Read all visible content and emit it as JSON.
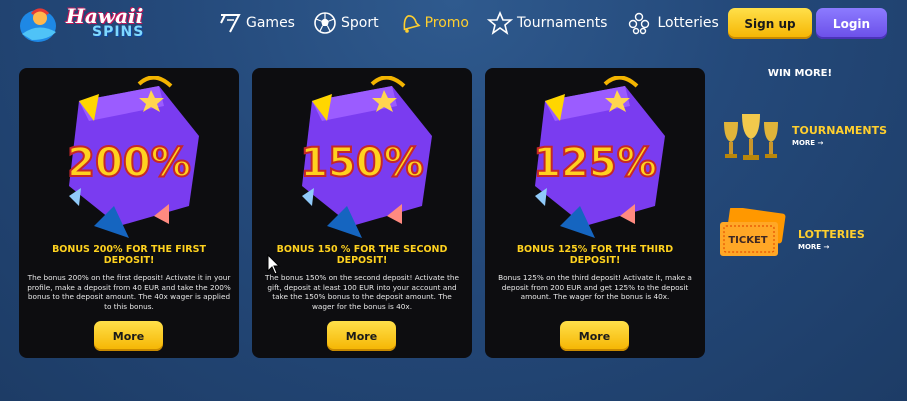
{
  "logo": {
    "line1": "Hawaii",
    "line2": "SPINS"
  },
  "nav": [
    {
      "label": "Games",
      "icon": "seven-icon"
    },
    {
      "label": "Sport",
      "icon": "soccer-ball-icon"
    },
    {
      "label": "Promo",
      "icon": "bell-icon",
      "active": true
    },
    {
      "label": "Tournaments",
      "icon": "star-icon"
    },
    {
      "label": "Lotteries",
      "icon": "lottery-balls-icon"
    }
  ],
  "auth": {
    "signup": "Sign up",
    "login": "Login"
  },
  "cards": [
    {
      "percent": "200%",
      "title": "BONUS 200% FOR THE FIRST DEPOSIT!",
      "description": "The bonus 200% on the first deposit! Activate it in your profile, make a deposit from 40 EUR and take the 200% bonus to the deposit amount. The 40x wager is applied to this bonus.",
      "button": "More"
    },
    {
      "percent": "150%",
      "title": "BONUS 150 % FOR THE SECOND DEPOSIT!",
      "description": "The bonus 150% on the second deposit! Activate the gift, deposit at least 100 EUR into your account and take the 150% bonus to the deposit amount. The wager for the bonus is 40x.",
      "button": "More"
    },
    {
      "percent": "125%",
      "title": "BONUS 125% FOR THE THIRD DEPOSIT!",
      "description": "Bonus 125% on the third deposit! Activate it, make a deposit from 200 EUR and get 125% to the deposit amount. The wager for the bonus is 40x.",
      "button": "More"
    }
  ],
  "sidebar": {
    "heading": "WIN MORE!",
    "items": [
      {
        "label": "TOURNAMENTS",
        "sub": "MORE →",
        "icon": "trophy-icon"
      },
      {
        "label": "LOTTERIES",
        "sub": "MORE →",
        "icon": "ticket-icon",
        "ticket_text": "TICKET"
      }
    ]
  },
  "colors": {
    "accent": "#ffcf2e",
    "card_bg": "#0d0d10",
    "login": "#7a63f5"
  }
}
